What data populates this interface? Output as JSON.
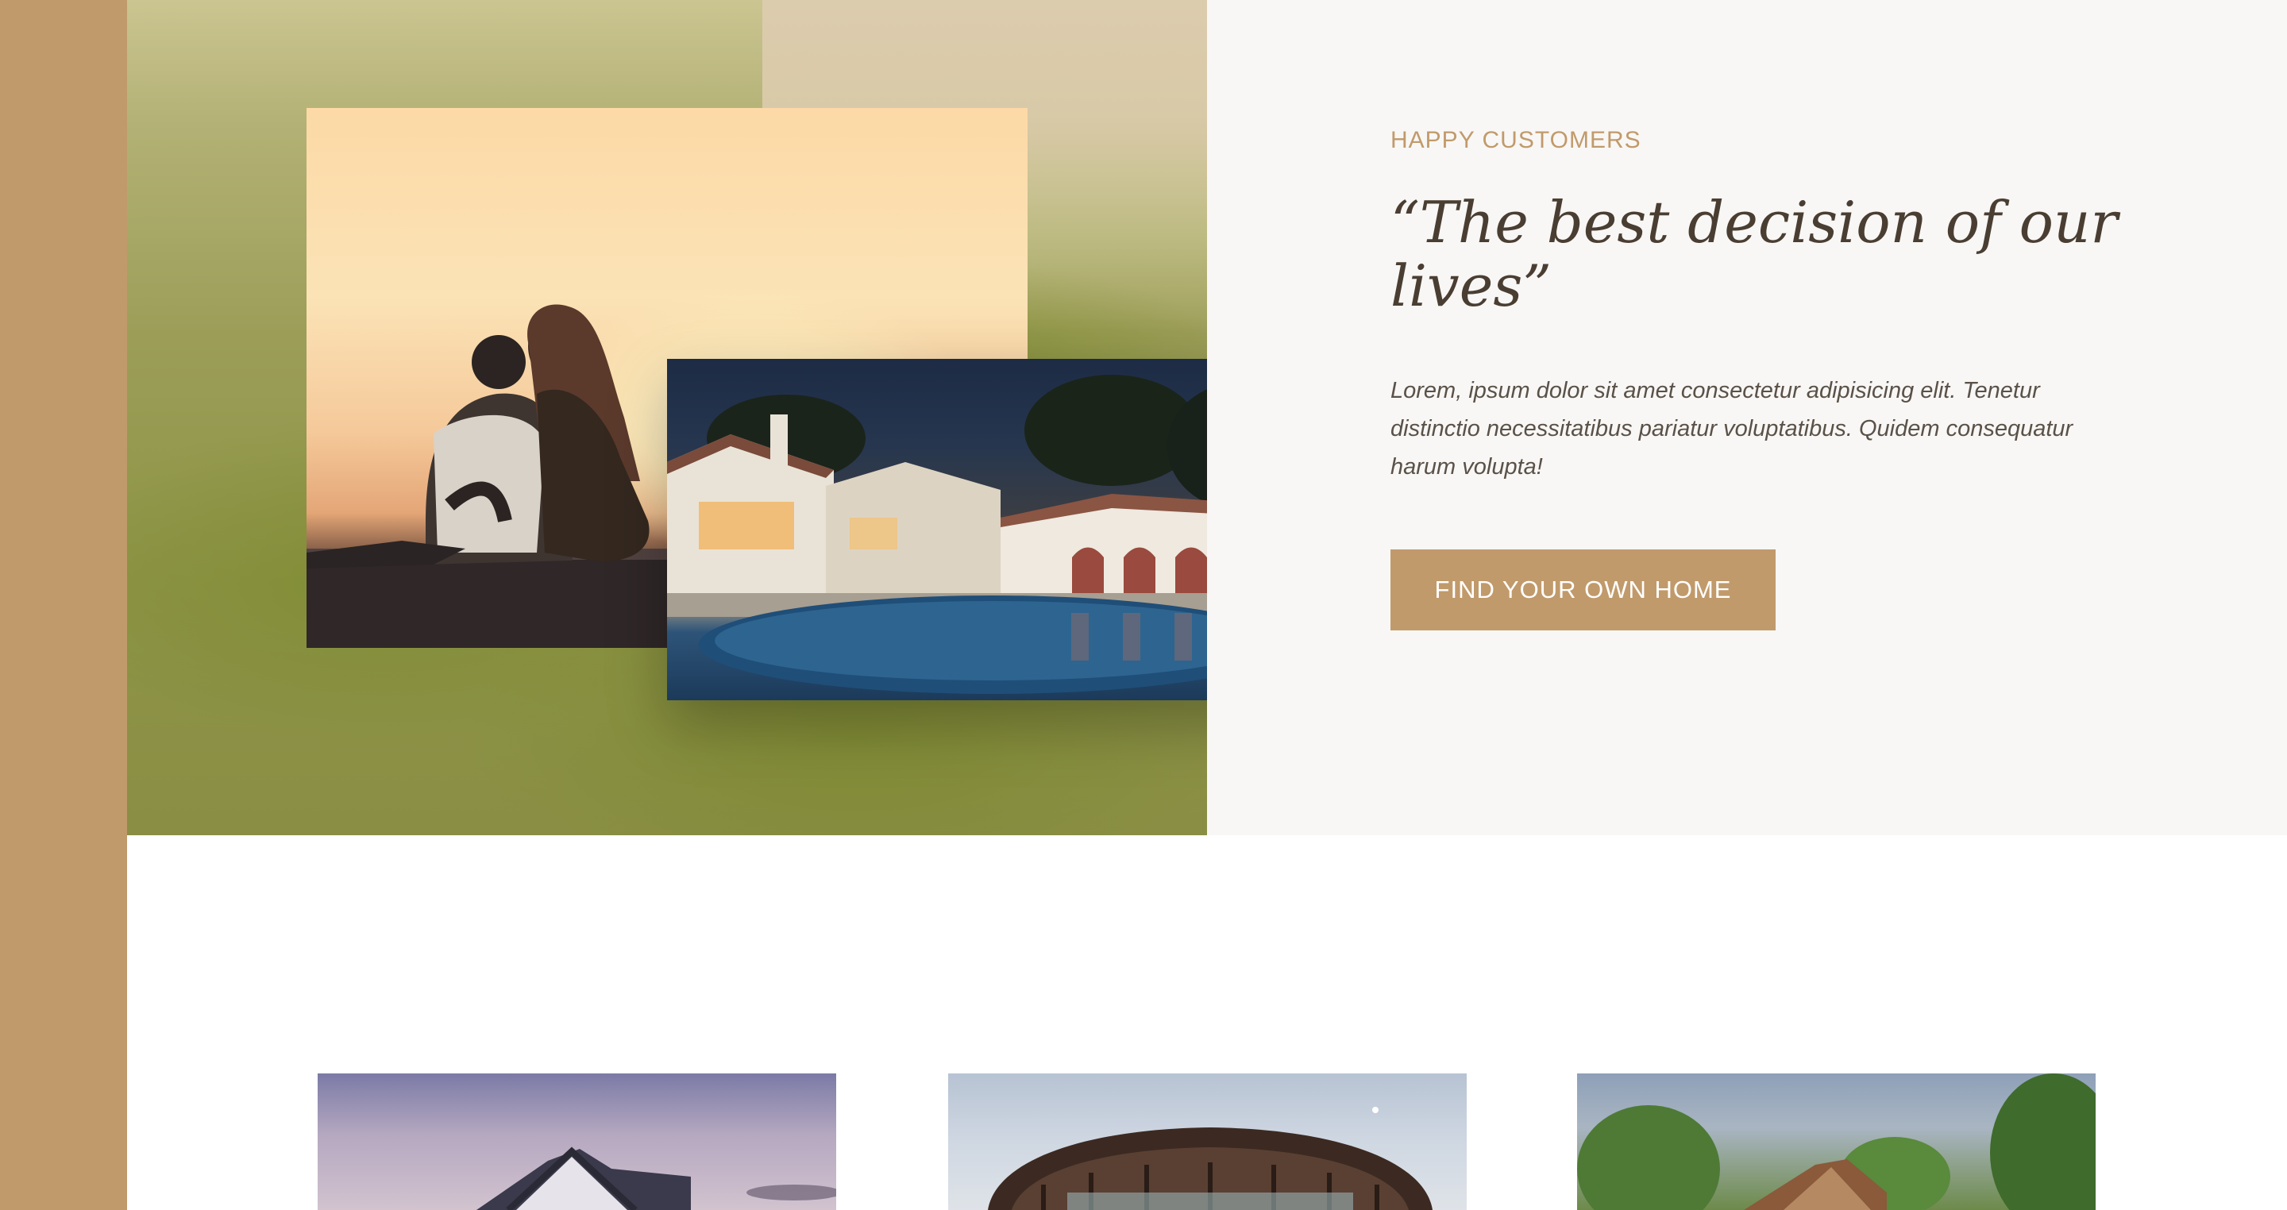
{
  "testimonial": {
    "eyebrow": "HAPPY CUSTOMERS",
    "quote": "“The best decision of our lives”",
    "body": "Lorem, ipsum dolor sit amet consectetur adipisicing elit. Tenetur distinctio necessitatibus pariatur voluptatibus. Quidem consequatur harum volupta!",
    "cta_label": "FIND YOUR OWN HOME"
  },
  "gallery": {
    "photos": [
      {
        "name": "couple-sunset-photo"
      },
      {
        "name": "villa-pool-night-photo"
      }
    ]
  },
  "homes": {
    "cards": [
      {
        "name": "house-photo-1"
      },
      {
        "name": "house-photo-2"
      },
      {
        "name": "house-photo-3"
      }
    ]
  },
  "colors": {
    "accent": "#c19a6b",
    "heading": "#4a3e33",
    "panel_bg": "#f8f7f5"
  }
}
